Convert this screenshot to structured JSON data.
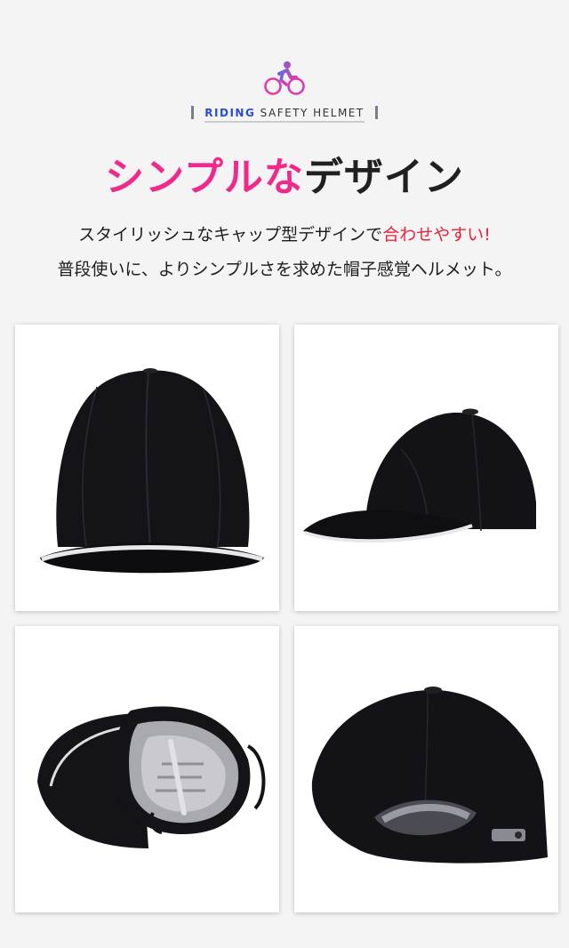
{
  "brand": {
    "logo_icon": "bicycle-rider-icon",
    "tag_highlight": "RIDING",
    "tag_rest": "SAFETY HELMET"
  },
  "headline": {
    "pink": "シンプルな",
    "dark": "デザイン"
  },
  "subtext": {
    "line1_main": "スタイリッシュなキャップ型デザインで",
    "line1_accent": "合わせやすい!",
    "line2": "普段使いに、よりシンプルさを求めた帽子感覚ヘルメット。"
  },
  "colors": {
    "pink": "#ef2a8a",
    "accent_red": "#e8243c",
    "riding_blue": "#2a4bd6",
    "cap_black": "#121216"
  },
  "gallery": {
    "images": [
      "cap-front-view",
      "cap-side-view",
      "cap-underside-view",
      "cap-back-view"
    ]
  }
}
